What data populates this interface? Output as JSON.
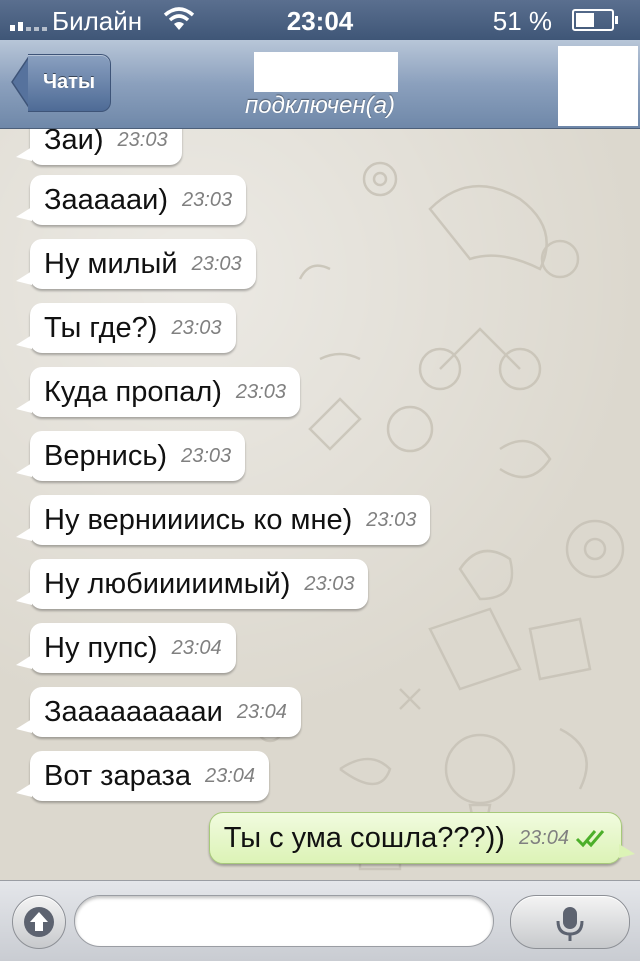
{
  "status_bar": {
    "carrier": "Билайн",
    "time": "23:04",
    "battery": "51 %"
  },
  "nav": {
    "back_label": "Чаты",
    "status": "подключен(а)"
  },
  "messages": [
    {
      "text": "Заи)",
      "time": "23:03",
      "direction": "in"
    },
    {
      "text": "Заааааи)",
      "time": "23:03",
      "direction": "in"
    },
    {
      "text": "Ну милый",
      "time": "23:03",
      "direction": "in"
    },
    {
      "text": "Ты где?)",
      "time": "23:03",
      "direction": "in"
    },
    {
      "text": "Куда пропал)",
      "time": "23:03",
      "direction": "in"
    },
    {
      "text": "Вернись)",
      "time": "23:03",
      "direction": "in"
    },
    {
      "text": "Ну верниииись ко мне)",
      "time": "23:03",
      "direction": "in"
    },
    {
      "text": "Ну любииииимый)",
      "time": "23:03",
      "direction": "in"
    },
    {
      "text": "Ну пупс)",
      "time": "23:04",
      "direction": "in"
    },
    {
      "text": "Заааааааааи",
      "time": "23:04",
      "direction": "in"
    },
    {
      "text": "Вот зараза",
      "time": "23:04",
      "direction": "in"
    },
    {
      "text": "Ты с ума сошла???))",
      "time": "23:04",
      "direction": "out",
      "read": true
    }
  ],
  "input": {
    "placeholder": ""
  },
  "colors": {
    "ticks": "#4caf2a",
    "nav": "#6f88a9"
  },
  "icons": {
    "attach": "upload-arrow-icon",
    "mic": "microphone-icon",
    "back": "back-chevron-icon"
  }
}
